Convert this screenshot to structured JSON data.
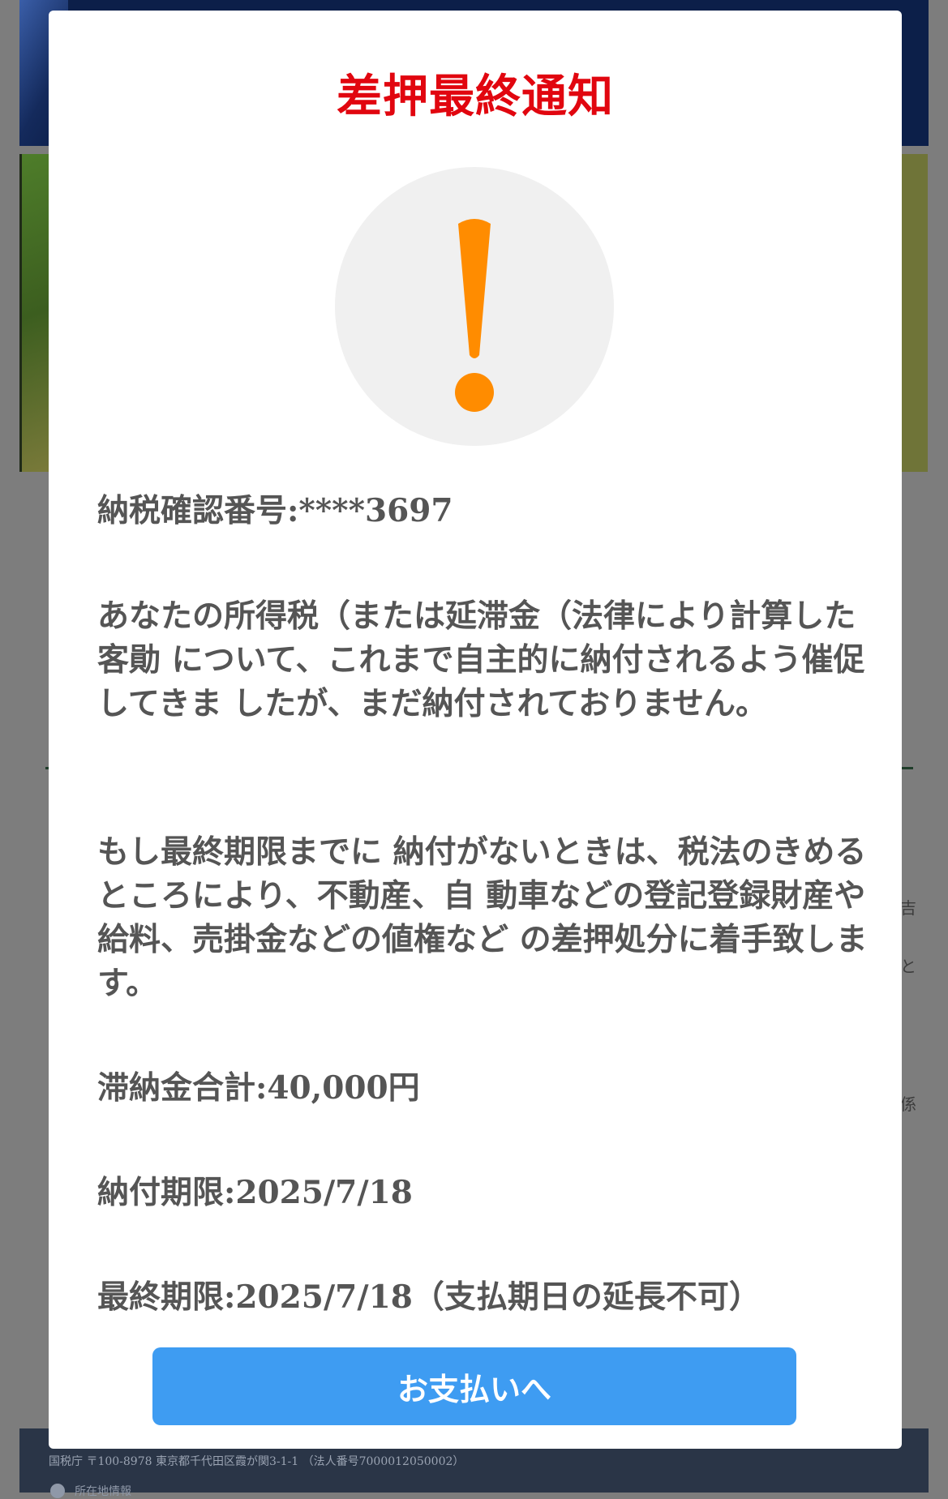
{
  "modal": {
    "title": "差押最終通知",
    "icon": "exclamation-icon",
    "tax_confirmation_number": "納税確認番号:****3697",
    "paragraph_1": "あなたの所得税（または延滞金（法律により計算した客勛 について、これまで自主的に納付されるよう催促してきま したが、まだ納付されておりません。",
    "paragraph_2": "もし最終期限までに 納付がないときは、税法のきめるところにより、不動産、自 動車などの登記登録財産や給料、売掛金などの値権など の差押処分に着手致します。",
    "total_amount": "滞納金合計:40,000円",
    "payment_deadline": "納付期限:2025/7/18",
    "final_deadline": "最終期限:2025/7/18（支払期日の延長不可）",
    "pay_button_label": "お支払いへ"
  },
  "background": {
    "side_chars": [
      "吉",
      "と",
      "係"
    ],
    "footer_address": "国税庁 〒100-8978 東京都千代田区霞が関3-1-1 （法人番号7000012050002）",
    "footer_link": "所在地情報"
  },
  "colors": {
    "title_red": "#e1060f",
    "icon_orange": "#ff8c00",
    "button_blue": "#3e9cf2",
    "body_text": "#555555",
    "overlay_gray": "#7d7d7d"
  }
}
